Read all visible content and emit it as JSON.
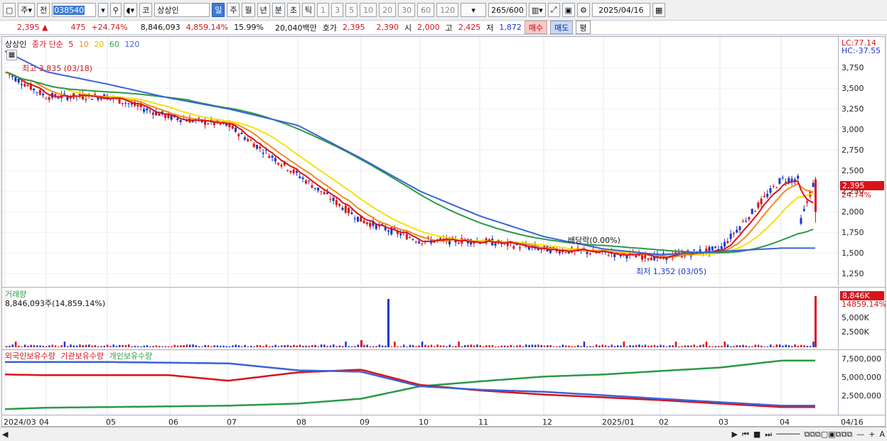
{
  "toolbar": {
    "market": "주",
    "compare": "전",
    "code": "038540",
    "name": "상상인",
    "periods": [
      "일",
      "주",
      "월",
      "년",
      "분",
      "초",
      "틱"
    ],
    "nums": [
      "1",
      "3",
      "5",
      "10",
      "20",
      "30",
      "60",
      "120"
    ],
    "count": "265",
    "count_total": "/600",
    "date": "2025/04/16"
  },
  "quote": {
    "price": "2,395",
    "change": "475",
    "pct": "+24.74%",
    "volume": "8,846,093",
    "vol_pct": "4,859.14%",
    "turnover": "15.99%",
    "amount": "20,040백만",
    "bid_label": "호가",
    "bid1": "2,395",
    "bid2": "2,390",
    "open_label": "시",
    "open": "2,000",
    "high_label": "고",
    "high": "2,425",
    "low_label": "저",
    "low": "1,872",
    "buy": "매수",
    "sell": "매도",
    "eval": "평"
  },
  "main_legend": {
    "name": "상상인",
    "ma_label": "종가 단순",
    "ma": [
      "5",
      "10",
      "20",
      "60",
      "120"
    ],
    "lc": "LC:77.14",
    "hc": "HC:-37.55"
  },
  "colors": {
    "ma5": "#d8131a",
    "ma10": "#f08a1c",
    "ma20": "#f2e20a",
    "ma60": "#2a9a45",
    "ma120": "#3a62d8",
    "up": "#d8131a",
    "down": "#1a36c9"
  },
  "price_ticks": [
    "3,750",
    "3,500",
    "3,250",
    "3,000",
    "2,750",
    "2,500",
    "2,250",
    "2,000",
    "1,750",
    "1,500",
    "1,250"
  ],
  "price_badge": {
    "price": "2,395",
    "pct": "24.74%"
  },
  "annotations": {
    "high": "최고 3,835 (03/18)",
    "low": "최저 1,352 (03/05)",
    "dividend": "배당락(0.00%)"
  },
  "volume": {
    "title": "거래량",
    "value": "8,846,093주(14,859.14%)",
    "ticks": [
      "5,000K",
      "2,500K"
    ],
    "badge1": "8,846K",
    "badge2": "14859.14%"
  },
  "holdings": {
    "legend": [
      "외국인보유수량",
      "기관보유수량",
      "개인보유수량"
    ],
    "ticks": [
      "7,500,000",
      "5,000,000",
      "2,500,000"
    ]
  },
  "x_labels": [
    "2024/03",
    "04",
    "05",
    "06",
    "07",
    "08",
    "09",
    "10",
    "11",
    "12",
    "2025/01",
    "02",
    "03",
    "04",
    "04/16"
  ],
  "chart_data": {
    "type": "candlestick",
    "x": [
      "2024/03",
      "04",
      "05",
      "06",
      "07",
      "08",
      "09",
      "10",
      "11",
      "12",
      "2025/01",
      "02",
      "03",
      "04"
    ],
    "close_approx": [
      3700,
      3400,
      3400,
      3150,
      3050,
      2450,
      1900,
      1650,
      1650,
      1550,
      1500,
      1450,
      1550,
      2395
    ],
    "ma120_approx": [
      3950,
      3700,
      3550,
      3380,
      3250,
      3050,
      2650,
      2250,
      1950,
      1700,
      1550,
      1480,
      1520,
      1560
    ],
    "foreign_holdings_approx": [
      7300000,
      7300000,
      7300000,
      7200000,
      7100000,
      6100000,
      5900000,
      3800000,
      3300000,
      3000000,
      2500000,
      2000000,
      1500000,
      1000000
    ],
    "individual_holdings_approx": [
      500000,
      700000,
      800000,
      900000,
      1000000,
      1300000,
      2000000,
      3800000,
      4500000,
      5200000,
      5500000,
      6000000,
      6500000,
      7500000
    ],
    "institution_holdings_approx": [
      5500000,
      5400000,
      5400000,
      5400000,
      4600000,
      5800000,
      6200000,
      4000000,
      3200000,
      2600000,
      2200000,
      1800000,
      1300000,
      800000
    ]
  },
  "scroll": {
    "bar": "─────"
  }
}
